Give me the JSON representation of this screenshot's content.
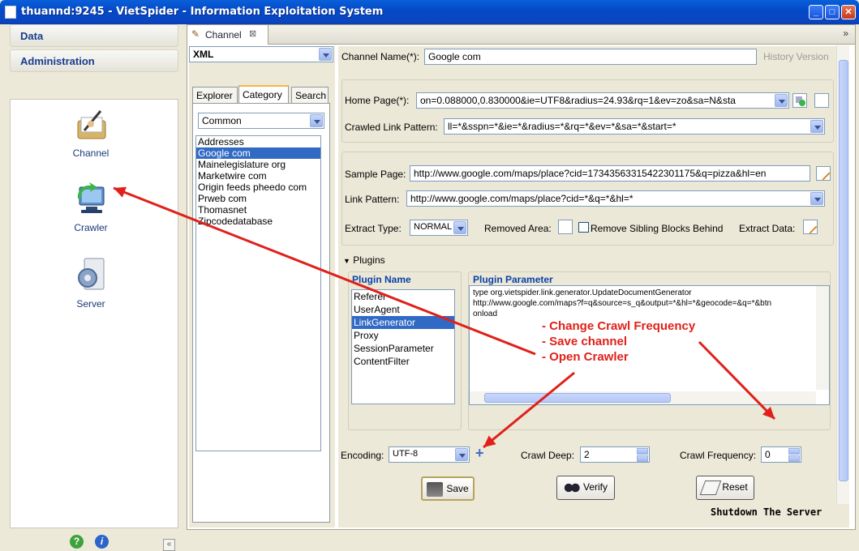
{
  "window": {
    "title": "thuannd:9245 - VietSpider - Information Exploitation System"
  },
  "nav": {
    "sections": [
      "Data",
      "Administration"
    ],
    "items": [
      {
        "label": "Channel",
        "icon": "channel-icon"
      },
      {
        "label": "Crawler",
        "icon": "crawler-icon"
      },
      {
        "label": "Server",
        "icon": "server-icon"
      }
    ]
  },
  "editor": {
    "tab": "Channel"
  },
  "category": {
    "type": "XML",
    "tabs": [
      "Explorer",
      "Category",
      "Search"
    ],
    "group": "Common",
    "items": [
      "Addresses",
      "Google com",
      "Mainelegislature org",
      "Marketwire com",
      "Origin feeds pheedo com",
      "Prweb com",
      "Thomasnet",
      "Zipcodedatabase"
    ],
    "selected": "Google com"
  },
  "form": {
    "channel_name_label": "Channel Name(*):",
    "channel_name": "Google com",
    "history_version": "History Version",
    "home_page_label": "Home Page(*):",
    "home_page": "on=0.088000,0.830000&ie=UTF8&radius=24.93&rq=1&ev=zo&sa=N&sta",
    "crawled_link_pattern_label": "Crawled Link Pattern:",
    "crawled_link_pattern": "ll=*&sspn=*&ie=*&radius=*&rq=*&ev=*&sa=*&start=*",
    "sample_page_label": "Sample Page:",
    "sample_page": "http://www.google.com/maps/place?cid=17343563315422301175&q=pizza&hl=en",
    "link_pattern_label": "Link Pattern:",
    "link_pattern": "http://www.google.com/maps/place?cid=*&q=*&hl=*",
    "extract_type_label": "Extract Type:",
    "extract_type": "NORMAL",
    "removed_area_label": "Removed Area:",
    "remove_sibling_label": "Remove Sibling Blocks Behind",
    "extract_data_label": "Extract Data:",
    "plugins_label": "Plugins",
    "plugin_name_label": "Plugin Name",
    "plugin_parameter_label": "Plugin Parameter",
    "plugins": [
      "Referer",
      "UserAgent",
      "LinkGenerator",
      "Proxy",
      "SessionParameter",
      "ContentFilter"
    ],
    "selected_plugin": "LinkGenerator",
    "param_line1": "type org.vietspider.link.generator.UpdateDocumentGenerator",
    "param_line2": "http://www.google.com/maps?f=q&source=s_q&output=*&hl=*&geocode=&q=*&btn",
    "param_line3": "onload",
    "encoding_label": "Encoding:",
    "encoding": "UTF-8",
    "crawl_deep_label": "Crawl Deep:",
    "crawl_deep": "2",
    "crawl_frequency_label": "Crawl Frequency:",
    "crawl_frequency": "0",
    "save": "Save",
    "verify": "Verify",
    "reset": "Reset"
  },
  "footer": {
    "shutdown": "Shutdown The Server"
  },
  "annotation": {
    "line1": "- Change Crawl Frequency",
    "line2": "- Save channel",
    "line3": "- Open Crawler",
    "color": "#e0201a"
  }
}
